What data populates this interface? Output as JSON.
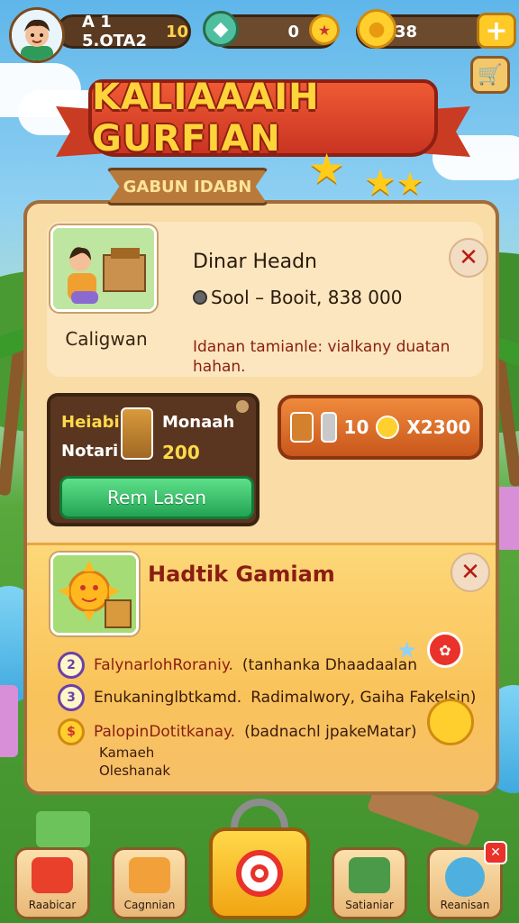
{
  "hud": {
    "player_name": "A 1 5.OTA2",
    "player_level": "10",
    "resource1_value": "0",
    "resource2_value": "38",
    "add_label": "+"
  },
  "banner": {
    "title": "KALIAAAIH GURFIAN",
    "subtitle": "GABUN IDABN"
  },
  "card1": {
    "thumb_caption": "Caligwan",
    "title": "Dinar Headn",
    "subtitle": "Sool – Booit, 838 000",
    "description": "Idanan tamianle: vialkany duatan hahan.",
    "close_label": "✕"
  },
  "offer": {
    "left_line1": "Heiabi",
    "left_line2": "Notari",
    "right_line1": "Monaah",
    "right_line2": "200",
    "button_label": "Rem Lasen",
    "price_count": "10",
    "price_total": "X2300"
  },
  "card2": {
    "title": "Hadtik Gamiam",
    "close_label": "✕",
    "rows": [
      {
        "badge": "2",
        "label": "FalynarlohRoraniy.",
        "detail": "(tanhanka Dhaadaalan"
      },
      {
        "badge": "3",
        "label": "Enukaninglbtkamd.",
        "detail": "Radimalwory,  Gaiha Fakelsin)"
      },
      {
        "badge": "$",
        "label": "PalopinDotitkanay.",
        "detail": "(badnachl jpakeMatar)"
      }
    ],
    "extra_lines": [
      "Kamaeh",
      "Oleshanak"
    ]
  },
  "nav": {
    "items": [
      {
        "label": "Raabicar"
      },
      {
        "label": "Cagnnian"
      },
      {
        "label": "Satianiar"
      },
      {
        "label": "Reanisan"
      }
    ],
    "badge_label": "✕"
  },
  "colors": {
    "panel_bg": "#f9dca6",
    "banner_red": "#c93422",
    "title_yellow": "#ffd43b",
    "button_green": "#22a454",
    "button_orange": "#c9571c"
  }
}
